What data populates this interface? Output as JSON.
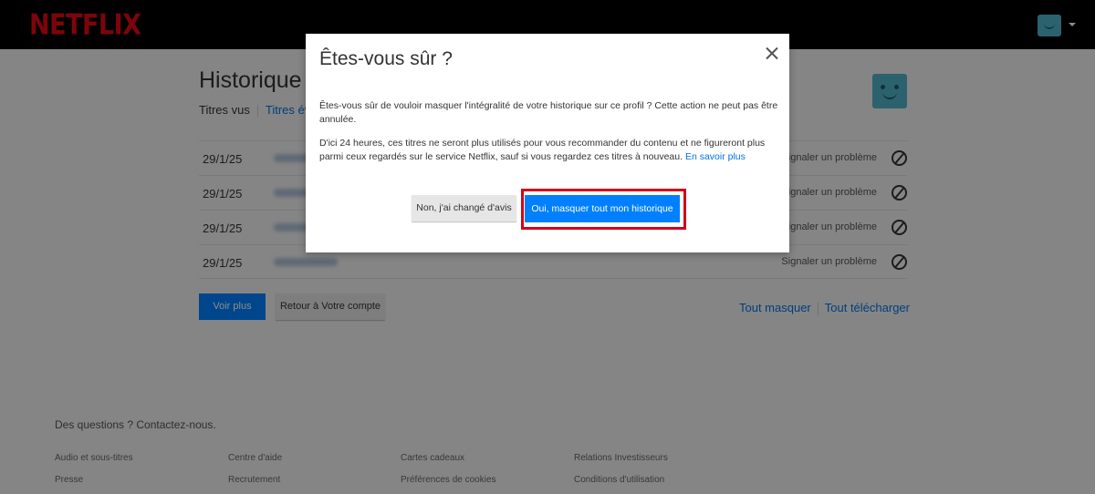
{
  "header": {
    "logo": "NETFLIX"
  },
  "page": {
    "title": "Historique",
    "subnav": {
      "viewed": "Titres vus",
      "rated": "Titres éva"
    },
    "rows": [
      {
        "date": "29/1/25",
        "report": "Signaler un problème"
      },
      {
        "date": "29/1/25",
        "report": "Signaler un problème"
      },
      {
        "date": "29/1/25",
        "report": "Signaler un problème"
      },
      {
        "date": "29/1/25",
        "report": "Signaler un problème"
      }
    ],
    "more_label": "Voir plus",
    "back_label": "Retour à Votre compte",
    "hide_all": "Tout masquer",
    "download_all": "Tout télécharger"
  },
  "footer": {
    "question": "Des questions ? Contactez-nous.",
    "links": [
      [
        "Audio et sous-titres",
        "Presse"
      ],
      [
        "Centre d'aide",
        "Recrutement"
      ],
      [
        "Cartes cadeaux",
        "Préférences de cookies"
      ],
      [
        "Relations Investisseurs",
        "Conditions d'utilisation"
      ]
    ]
  },
  "modal": {
    "title": "Êtes-vous sûr ?",
    "paragraph1": "Êtes-vous sûr de vouloir masquer l'intégralité de votre historique sur ce profil ? Cette action ne peut pas être annulée.",
    "paragraph2": "D'ici 24 heures, ces titres ne seront plus utilisés pour vous recommander du contenu et ne figureront plus parmi ceux regardés sur le service Netflix, sauf si vous regardez ces titres à nouveau.",
    "learn_more": "En savoir plus",
    "cancel_label": "Non, j'ai changé d'avis",
    "confirm_label": "Oui, masquer tout mon historique"
  },
  "colors": {
    "brand": "#e50914",
    "accent": "#0080ff",
    "highlight": "#d0021b"
  },
  "icons": [
    "close-icon",
    "hide-icon",
    "avatar-icon",
    "chevron-down-icon"
  ]
}
